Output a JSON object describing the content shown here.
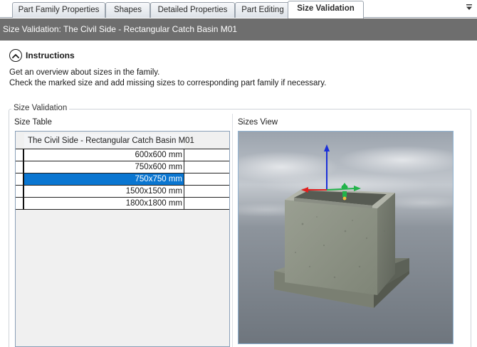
{
  "tabs": [
    {
      "label": "Part Family Properties",
      "active": false
    },
    {
      "label": "Shapes",
      "active": false
    },
    {
      "label": "Detailed Properties",
      "active": false
    },
    {
      "label": "Part Editing",
      "active": false
    },
    {
      "label": "Size Validation",
      "active": true
    }
  ],
  "header": {
    "title": "Size Validation:   The Civil Side - Rectangular Catch Basin M01"
  },
  "instructions": {
    "title": "Instructions",
    "expanded": true,
    "line1": "Get an overview about sizes in the family.",
    "line2": "Check the marked size and add missing sizes to corresponding part family if necessary."
  },
  "size_validation": {
    "group_label": "Size Validation",
    "size_table": {
      "label": "Size Table",
      "column_header": "The Civil Side - Rectangular Catch Basin M01",
      "rows": [
        "600x600 mm",
        "750x600 mm",
        "750x750 mm",
        "1500x1500 mm",
        "1800x1800 mm"
      ],
      "selected_row": "750x750 mm"
    },
    "sizes_view": {
      "label": "Sizes View"
    }
  },
  "colors": {
    "header_bg": "#6e6e6e",
    "selection": "#0a76d1",
    "axis_x": "#e02020",
    "axis_y": "#22b34a",
    "axis_z": "#1a2fd8"
  },
  "icons": {
    "tab_menu": "chevron-down-menu-icon",
    "collapse": "chevron-up-icon"
  }
}
